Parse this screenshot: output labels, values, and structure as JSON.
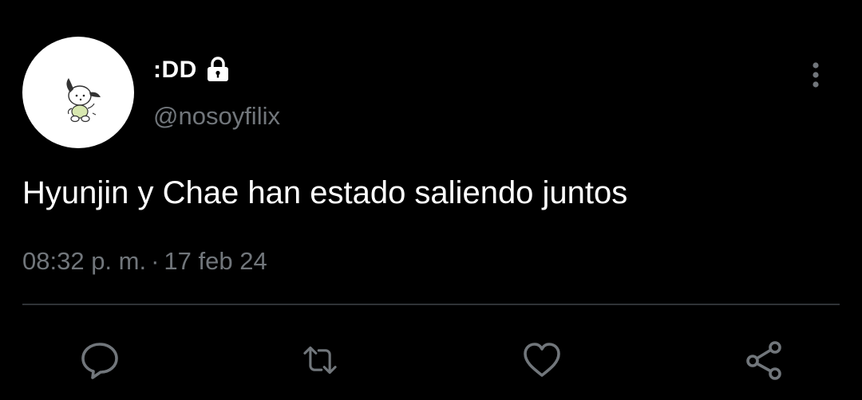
{
  "author": {
    "display_name": ":DD",
    "handle": "@nosoyfilix",
    "protected": true,
    "avatar_icon": "pochacco-avatar"
  },
  "tweet": {
    "text": "Hyunjin y Chae han estado saliendo juntos",
    "time": "08:32 p. m.",
    "separator": "·",
    "date": "17 feb 24"
  },
  "icons": {
    "lock": "lock-icon",
    "more": "more-vertical-icon",
    "reply": "reply-icon",
    "retweet": "retweet-icon",
    "like": "heart-icon",
    "share": "share-icon"
  },
  "colors": {
    "background": "#000000",
    "primary_text": "#ffffff",
    "secondary_text": "#71767b",
    "divider": "#2f3336",
    "icon": "#71767b"
  }
}
